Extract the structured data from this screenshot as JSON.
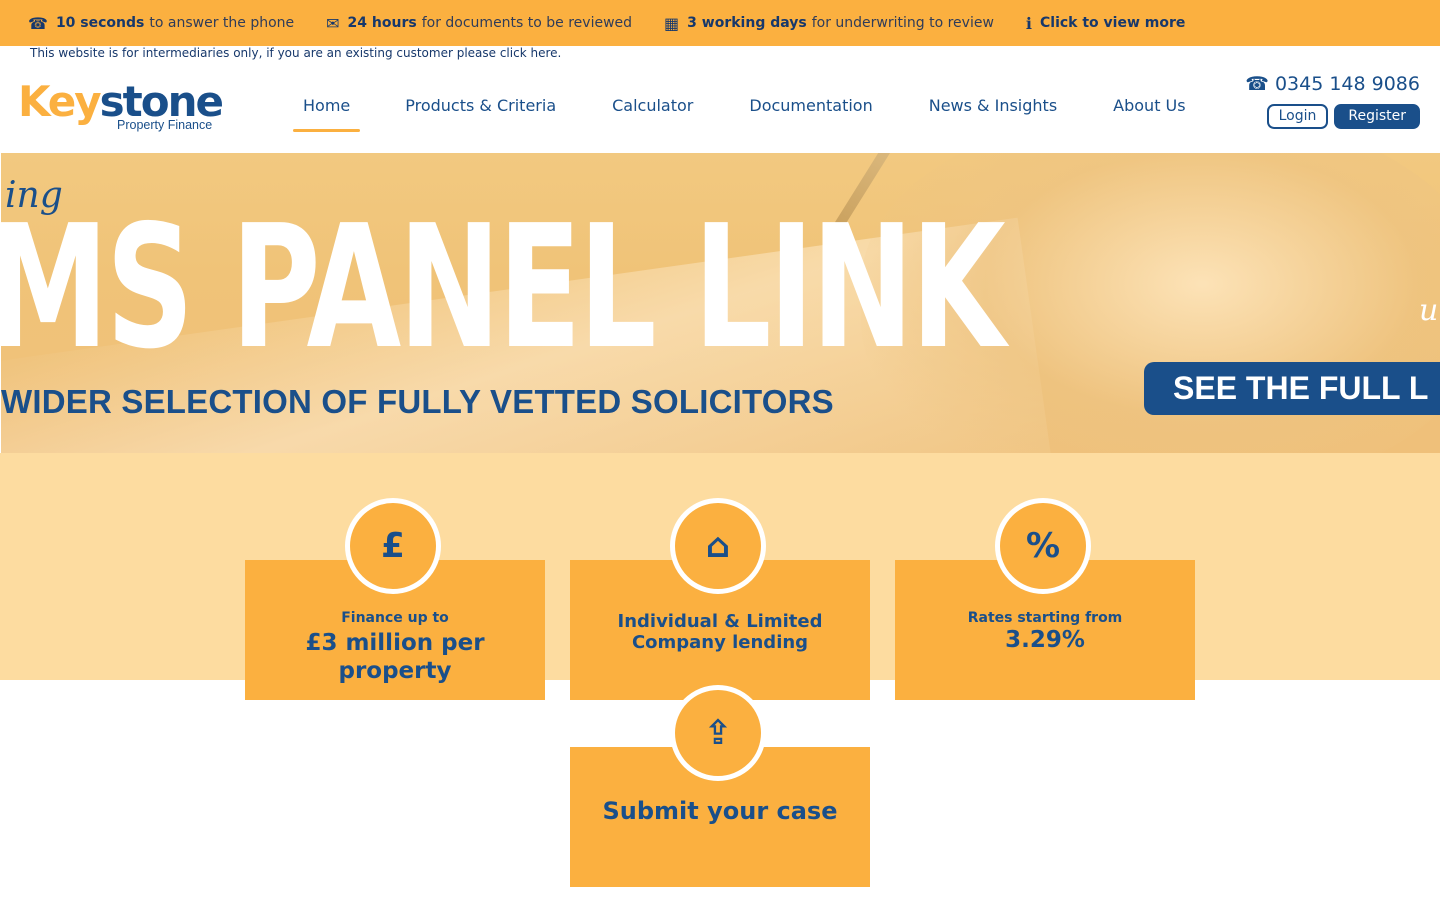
{
  "topbar": {
    "items": [
      {
        "icon": "phone-icon",
        "glyph": "☎",
        "bold": "10 seconds",
        "text": "to answer the phone"
      },
      {
        "icon": "document-icon",
        "glyph": "✉",
        "bold": "24 hours",
        "text": "for documents to be reviewed"
      },
      {
        "icon": "calendar-icon",
        "glyph": "▦",
        "bold": "3 working days",
        "text": "for underwriting to review"
      },
      {
        "icon": "info-icon",
        "glyph": "ℹ",
        "bold": "Click to view more",
        "text": ""
      }
    ]
  },
  "notice": "This website is for intermediaries only, if you are an existing customer please click here.",
  "logo": {
    "key": "Key",
    "stone": "stone",
    "sub": "Property Finance"
  },
  "nav": {
    "items": [
      "Home",
      "Products & Criteria",
      "Calculator",
      "Documentation",
      "News & Insights",
      "About Us"
    ],
    "active": "Home"
  },
  "header": {
    "phone_glyph": "☎",
    "phone": "0345 148 9086",
    "login": "Login",
    "register": "Register"
  },
  "hero": {
    "script_left": "ing",
    "script_right": "u",
    "headline": "MS PANEL LINK",
    "subline": "WIDER SELECTION OF FULLY VETTED SOLICITORS",
    "cta": "SEE THE FULL L"
  },
  "features": [
    {
      "icon": "pound-icon",
      "glyph": "£",
      "small": "Finance up to",
      "big": "£3 million per property"
    },
    {
      "icon": "building-icon",
      "glyph": "⌂",
      "mid": "Individual & Limited Company lending"
    },
    {
      "icon": "percent-icon",
      "glyph": "%",
      "small": "Rates starting from",
      "big": "3.29%"
    },
    {
      "icon": "upload-icon",
      "glyph": "⇪",
      "big": "Submit your case"
    }
  ],
  "colors": {
    "accent": "#fbb040",
    "brand": "#1a4f8a",
    "band": "#fddca0"
  }
}
